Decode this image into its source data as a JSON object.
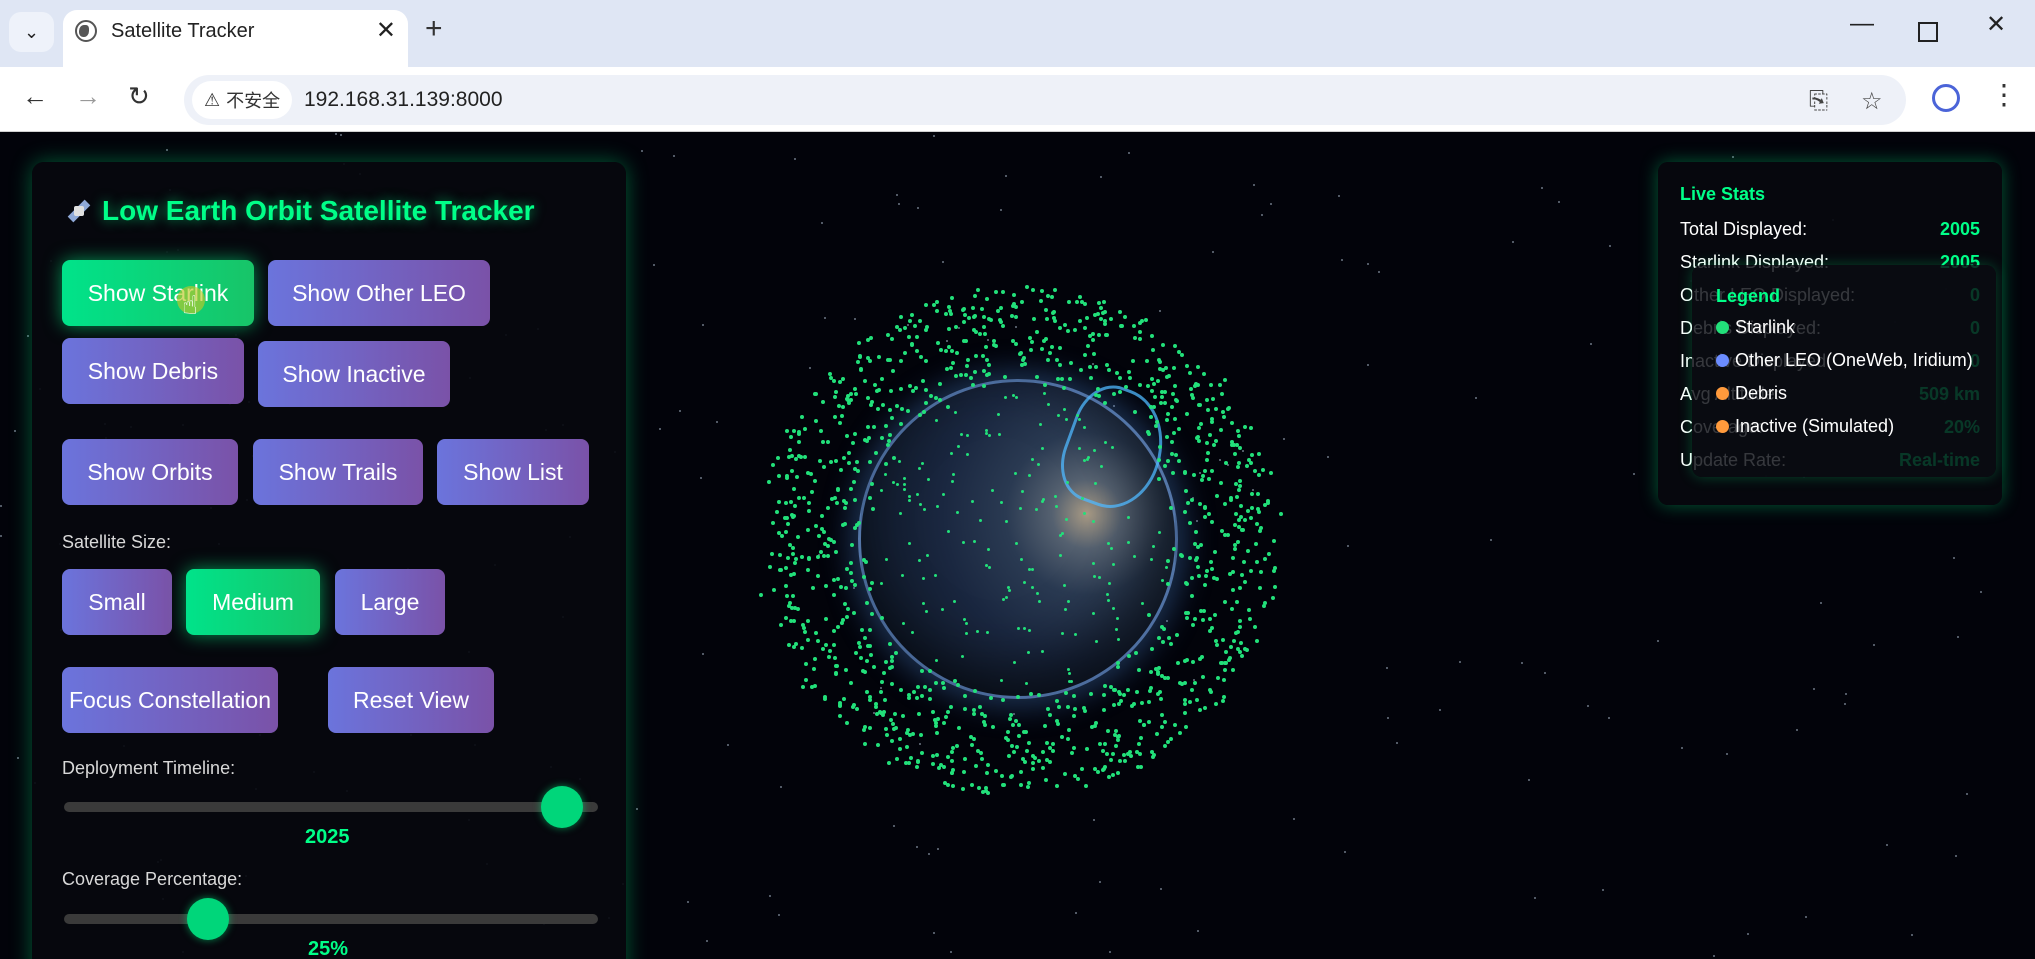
{
  "browser": {
    "tab_title": "Satellite Tracker",
    "security_label": "不安全",
    "url": "192.168.31.139:8000"
  },
  "panel": {
    "title": "Low Earth Orbit Satellite Tracker",
    "buttons": {
      "show_starlink": "Show Starlink",
      "show_other_leo": "Show Other LEO",
      "show_debris": "Show Debris",
      "show_inactive": "Show Inactive",
      "show_orbits": "Show Orbits",
      "show_trails": "Show Trails",
      "show_list": "Show List",
      "small": "Small",
      "medium": "Medium",
      "large": "Large",
      "focus_constellation": "Focus Constellation",
      "reset_view": "Reset View"
    },
    "size_label": "Satellite Size:",
    "timeline_label": "Deployment Timeline:",
    "timeline_value": "2025",
    "timeline_fraction": 0.97,
    "coverage_label": "Coverage Percentage:",
    "coverage_value": "25%",
    "coverage_fraction": 0.25
  },
  "stats": {
    "title": "Live Stats",
    "rows": [
      {
        "label": "Total Displayed:",
        "value": "2005"
      },
      {
        "label": "Starlink Displayed:",
        "value": "2005"
      },
      {
        "label": "Other LEO Displayed:",
        "value": "0"
      },
      {
        "label": "Debris Displayed:",
        "value": "0"
      },
      {
        "label": "Inactive Displayed:",
        "value": "0"
      },
      {
        "label": "Avg Altitude:",
        "value": "509 km"
      },
      {
        "label": "Coverage:",
        "value": "20%"
      },
      {
        "label": "Update Rate:",
        "value": "Real-time"
      }
    ]
  },
  "legend": {
    "title": "Legend",
    "items": [
      {
        "label": "Starlink",
        "color": "#22e07a"
      },
      {
        "label": "Other LEO (OneWeb, Iridium)",
        "color": "#6b8cff"
      },
      {
        "label": "Debris",
        "color": "#ff9a3c"
      },
      {
        "label": "Inactive (Simulated)",
        "color": "#ff9a3c"
      }
    ]
  }
}
